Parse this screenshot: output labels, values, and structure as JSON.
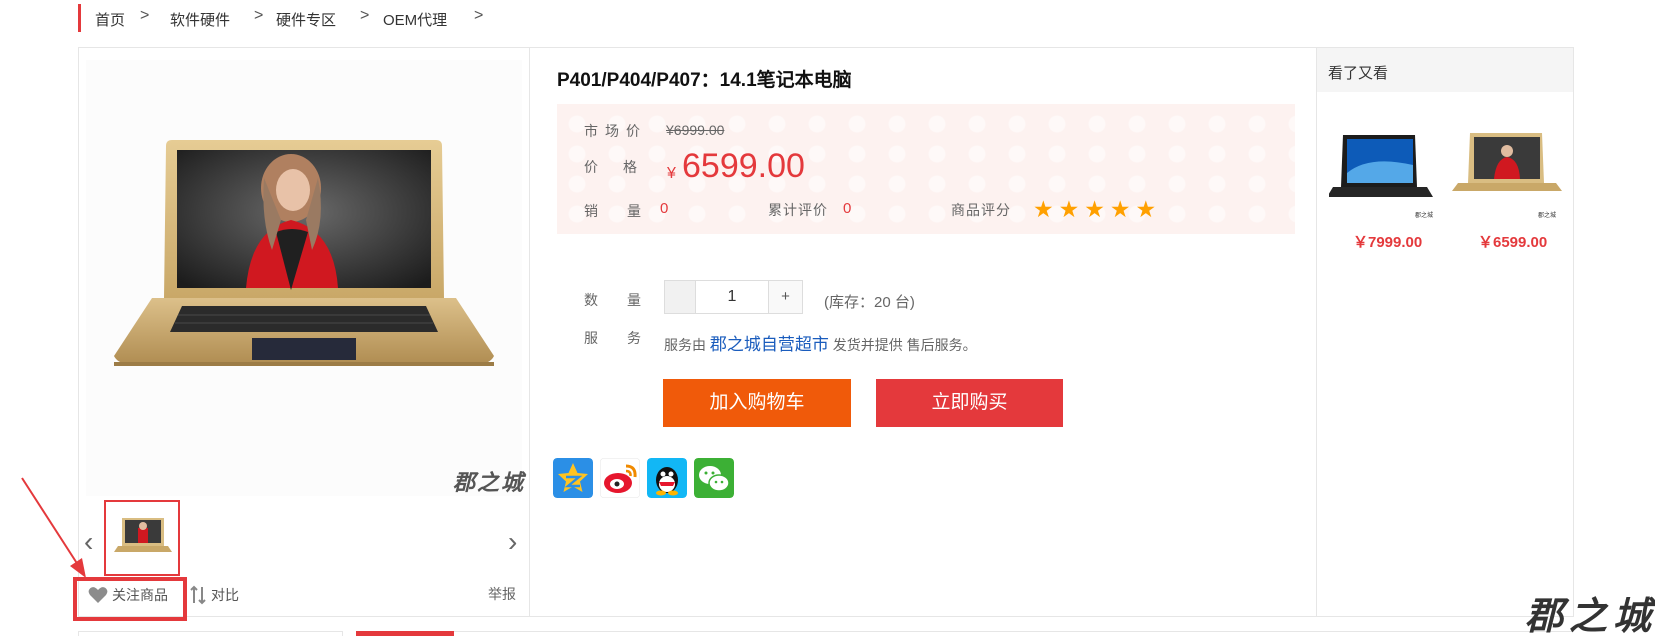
{
  "breadcrumb": {
    "items": [
      "首页",
      "软件硬件",
      "硬件专区",
      "OEM代理"
    ],
    "separator": ">"
  },
  "product": {
    "title": "P401/P404/P407：14.1笔记本电脑",
    "market_price_label": "市场价",
    "market_price": "¥6999.00",
    "price_label": "价格",
    "currency": "¥",
    "price": "6599.00",
    "sales_label": "销量",
    "sales": "0",
    "reviews_label": "累计评价",
    "reviews": "0",
    "rating_label": "商品评分",
    "rating": 5,
    "rating_max": 5
  },
  "purchase": {
    "qty_label": "数量",
    "qty": "1",
    "plus": "+",
    "stock": "(库存：20 台)",
    "service_label": "服务",
    "service_prefix": "服务由",
    "service_store": "郡之城自营超市",
    "service_suffix": "发货并提供 售后服务。",
    "add_to_cart": "加入购物车",
    "buy_now": "立即购买"
  },
  "gallery": {
    "watermark": "郡之城",
    "follow": "关注商品",
    "compare": "对比",
    "report": "举报"
  },
  "share": {
    "icons": [
      "qzone-icon",
      "weibo-icon",
      "qq-icon",
      "wechat-icon"
    ]
  },
  "sidebar": {
    "title": "看了又看",
    "items": [
      {
        "price": "￥7999.00"
      },
      {
        "price": "￥6599.00"
      }
    ]
  },
  "page_watermark": "郡之城",
  "colors": {
    "accent": "#e4393c",
    "cart_button": "#f05a0a",
    "star": "#ffa000",
    "link": "#1a5cbd"
  }
}
